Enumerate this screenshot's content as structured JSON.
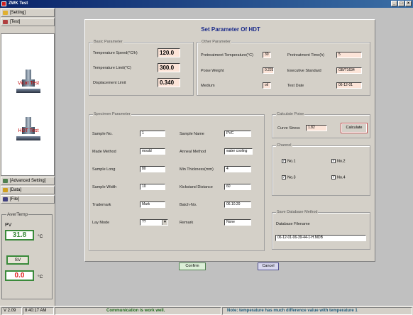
{
  "window": {
    "title": "ZWK Test",
    "controls": [
      "_",
      "□",
      "×"
    ]
  },
  "sidebar": {
    "top_items": [
      {
        "label": "[Setting]",
        "icon": "folder-icon",
        "color": "#e0b030"
      },
      {
        "label": "[Test]",
        "icon": "play-icon",
        "color": "#b04040"
      }
    ],
    "tools": [
      {
        "label": "Vicat Test"
      },
      {
        "label": "HDT Test"
      }
    ],
    "bottom_items": [
      {
        "label": "[Advanced Setting]",
        "icon": "advanced-icon",
        "color": "#508050"
      },
      {
        "label": "[Data]",
        "icon": "data-icon",
        "color": "#d0a020"
      },
      {
        "label": "[File]",
        "icon": "file-icon",
        "color": "#404080"
      }
    ],
    "temp": {
      "legend": "AverTemp",
      "pv_label": "PV",
      "pv_value": "31.8",
      "unit": "°C",
      "sv_label": "SV",
      "sv_value": "0.0"
    }
  },
  "main": {
    "title": "Set Parameter Of HDT",
    "basic": {
      "legend": "Basic Parameter",
      "rows": [
        {
          "label": "Temperature Speed(°C/h)",
          "value": "120.0"
        },
        {
          "label": "Temperature Limit(°C)",
          "value": "300.0"
        },
        {
          "label": "Displacement Limit",
          "value": "0.340"
        }
      ]
    },
    "other": {
      "legend": "Other Parameter",
      "pretreat_temp_label": "Pretreatment Temperature(°C)",
      "pretreat_temp_value": "30",
      "pretreat_time_label": "Pretreatment Time(h)",
      "pretreat_time_value": "5",
      "poise_weight_label": "Poise Weight",
      "poise_weight_value": "0.225",
      "exec_std_label": "Executive Standard",
      "exec_std_value": "GB/T1634",
      "medium_label": "Medium",
      "medium_value": "oil",
      "test_date_label": "Test Date",
      "test_date_value": "06-12-01"
    },
    "specimen": {
      "legend": "Specimen Parameter",
      "left": [
        {
          "label": "Sample No.",
          "value": "1"
        },
        {
          "label": "Made Method",
          "value": "mould"
        },
        {
          "label": "Sample Long",
          "value": "80"
        },
        {
          "label": "Sample Width",
          "value": "10"
        },
        {
          "label": "Trademark",
          "value": "Mark"
        },
        {
          "label": "Lay Mode",
          "value": "??"
        }
      ],
      "right": [
        {
          "label": "Sample Name",
          "value": "PVC"
        },
        {
          "label": "Anneal Method",
          "value": "water cooling"
        },
        {
          "label": "Min Thickness(mm)",
          "value": "4"
        },
        {
          "label": "Kickstand Distance",
          "value": "60"
        },
        {
          "label": "Batch-No.",
          "value": "06.10.20"
        },
        {
          "label": "Remark",
          "value": "None"
        }
      ]
    },
    "calc": {
      "legend": "Calculate Poise",
      "curve_label": "Curve Stress",
      "curve_value": "1.82",
      "button": "Calculate"
    },
    "channel": {
      "legend": "Channel",
      "items": [
        {
          "label": "No.1",
          "checked": true
        },
        {
          "label": "No.2",
          "checked": true
        },
        {
          "label": "No.3",
          "checked": true
        },
        {
          "label": "No.4",
          "checked": true
        }
      ]
    },
    "save": {
      "legend": "Save Database Method",
      "label": "Database Filename",
      "value": "06-12-01-06-39-44-1-H.MDB"
    },
    "confirm": "Confirm",
    "cancel": "Cancel"
  },
  "status": {
    "version": "V 2.09",
    "time": "8:40:17 AM",
    "comm": "Communication is work well.",
    "note": "Note: temperature has much difference value with temperature 1"
  }
}
